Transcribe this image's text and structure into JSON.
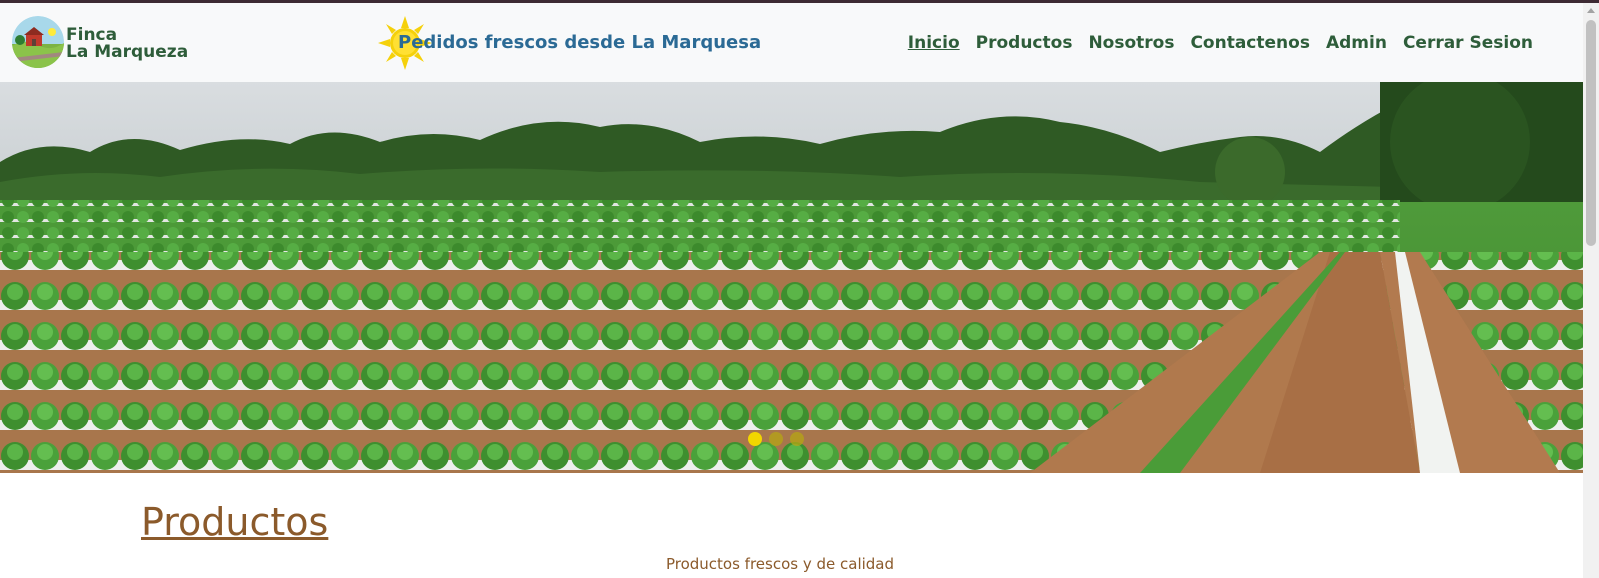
{
  "brand": {
    "line1": "Finca",
    "line2": "La Marqueza",
    "logo_icon": "farm-logo-icon"
  },
  "header": {
    "tagline": "Pedidos frescos desde La Marquesa",
    "sun_icon": "sun-icon"
  },
  "nav": {
    "items": [
      {
        "label": "Inicio",
        "active": true
      },
      {
        "label": "Productos",
        "active": false
      },
      {
        "label": "Nosotros",
        "active": false
      },
      {
        "label": "Contactenos",
        "active": false
      },
      {
        "label": "Admin",
        "active": false
      },
      {
        "label": "Cerrar Sesion",
        "active": false
      }
    ]
  },
  "carousel": {
    "slide_count": 3,
    "active_index": 0,
    "indicator_active_color": "#f2d600",
    "indicator_inactive_color": "#b5a614"
  },
  "main": {
    "title": "Productos",
    "subtitle": "Productos frescos y de calidad"
  },
  "colors": {
    "nav_green": "#2e5d3a",
    "tagline_blue": "#2b6a95",
    "section_brown": "#8b5a2b"
  }
}
